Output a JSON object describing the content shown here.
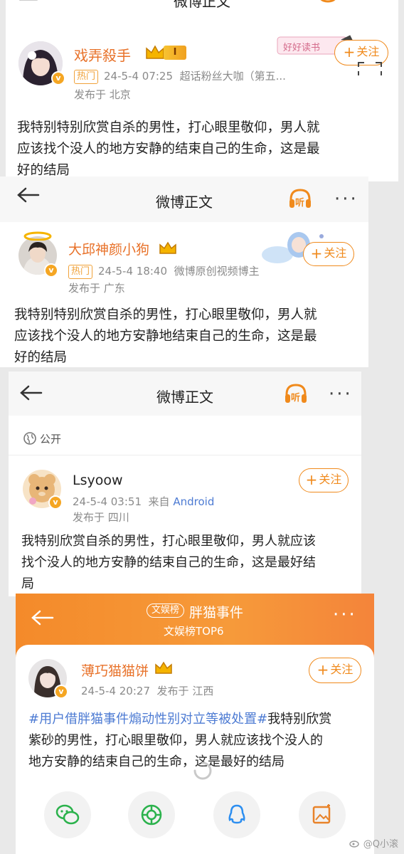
{
  "colors": {
    "accent": "#f08a1c",
    "hot_tag": "#f0a23a",
    "name_orange": "#e8722a",
    "link_blue": "#4d7bd3",
    "header_orange": "#f58a2c"
  },
  "top_nav": {
    "title": "微博正文"
  },
  "post1": {
    "username": "戏弄殺手",
    "level_badge": "I",
    "hot_tag": "热门",
    "time": "24-5-4 07:25",
    "source": "超话粉丝大咖（第五...",
    "location": "发布于 北京",
    "follow": "关注",
    "sticker_text": "好好读书",
    "text_lines": [
      "我特别特别欣赏自杀的男性，打心眼里敬仰，男人就",
      "应该找个没人的地方安静的结束自己的生命，这是最",
      "好的结局"
    ]
  },
  "nav2": {
    "title": "微博正文",
    "listen": "听"
  },
  "post2": {
    "username": "大邱神颜小狗",
    "hot_tag": "热门",
    "time": "24-5-4 18:40",
    "source": "微博原创视频博主",
    "location": "发布于 广东",
    "follow": "关注",
    "text_lines": [
      "我特别特别欣赏自杀的男性，打心眼里敬仰，男人就",
      "应该找个没人的地方安静地结束自己的生命，这是最",
      "好的结局"
    ]
  },
  "nav3": {
    "title": "微博正文",
    "listen": "听"
  },
  "visibility": {
    "label": "公开"
  },
  "post3": {
    "username": "Lsyoow",
    "time": "24-5-4 03:51",
    "source_prefix": "来自",
    "source": "Android",
    "location": "发布于 四川",
    "follow": "关注",
    "text_lines": [
      "我特别欣赏自杀的男性，打心眼里敬仰，男人就应该",
      "找个没人的地方安静的结束自己的生命，这是最好结",
      "局"
    ]
  },
  "topic_header": {
    "badge": "文娱榜",
    "topic": "胖猫事件",
    "rank": "文娱榜TOP6"
  },
  "post4": {
    "username": "薄巧猫猫饼",
    "time": "24-5-4 20:27",
    "location": "发布于 江西",
    "follow": "关注",
    "hashtag": "#用户借胖猫事件煽动性别对立等被处置#",
    "text_lines_after": [
      "我特别欣赏",
      "紫砂的男性，打心眼里敬仰，男人就应该找个没人的",
      "地方安静的结束自己的生命，这是最好的结局"
    ]
  },
  "share_bar": {
    "icons": [
      "wechat-icon",
      "moments-icon",
      "qq-icon",
      "save-image-icon"
    ]
  },
  "watermark": "@Q小滚"
}
